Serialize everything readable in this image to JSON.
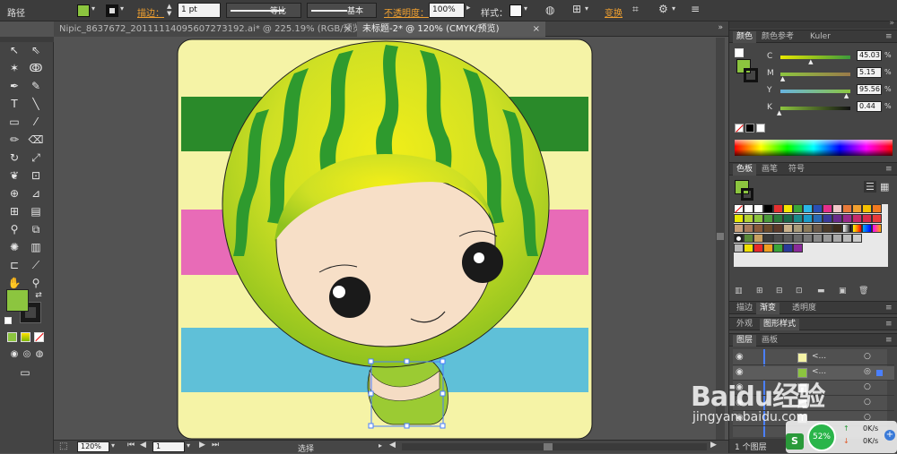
{
  "control_bar": {
    "object_type": "路径",
    "stroke_label": "描边：",
    "stroke_value": "1 pt",
    "profile_label": "等比",
    "brush_label": "基本",
    "opacity_label": "不透明度：",
    "opacity_value": "100%",
    "style_label": "样式：",
    "transform_label": "变换",
    "fill_color": "#8cc53f"
  },
  "tabs": [
    {
      "label": "Nipic_8637672_20111114095607273192.ai* @ 225.19% (RGB/预览)",
      "active": false
    },
    {
      "label": "未标题-2* @ 120% (CMYK/预览)",
      "active": true
    }
  ],
  "color_panel": {
    "tabs": [
      "颜色",
      "颜色参考",
      "Kuler"
    ],
    "channels": [
      {
        "name": "C",
        "value": "45.03",
        "level": 0.45
      },
      {
        "name": "M",
        "value": "5.15",
        "level": 0.05
      },
      {
        "name": "Y",
        "value": "95.56",
        "level": 0.96
      },
      {
        "name": "K",
        "value": "0.44",
        "level": 0.0
      }
    ]
  },
  "swatches_panel": {
    "tabs": [
      "色板",
      "画笔",
      "符号"
    ]
  },
  "stroke_panel": {
    "tabs": [
      "描边",
      "渐变",
      "透明度"
    ]
  },
  "appearance_panel": {
    "tabs": [
      "外观",
      "图形样式"
    ]
  },
  "layers_panel": {
    "tabs": [
      "图层",
      "画板"
    ],
    "rows": [
      {
        "label": "<..."
      },
      {
        "label": "<..."
      },
      {
        "label": ""
      },
      {
        "label": ""
      },
      {
        "label": ""
      }
    ],
    "footer": "1 个图层"
  },
  "status_bar": {
    "zoom": "120%",
    "artboard": "1",
    "tool_name": "选择"
  },
  "watermark": {
    "brand": "Baidu经验",
    "url": "jingyan.baidu.com"
  },
  "network_widget": {
    "percent": "52%",
    "up": "0K/s",
    "down": "0K/s"
  }
}
